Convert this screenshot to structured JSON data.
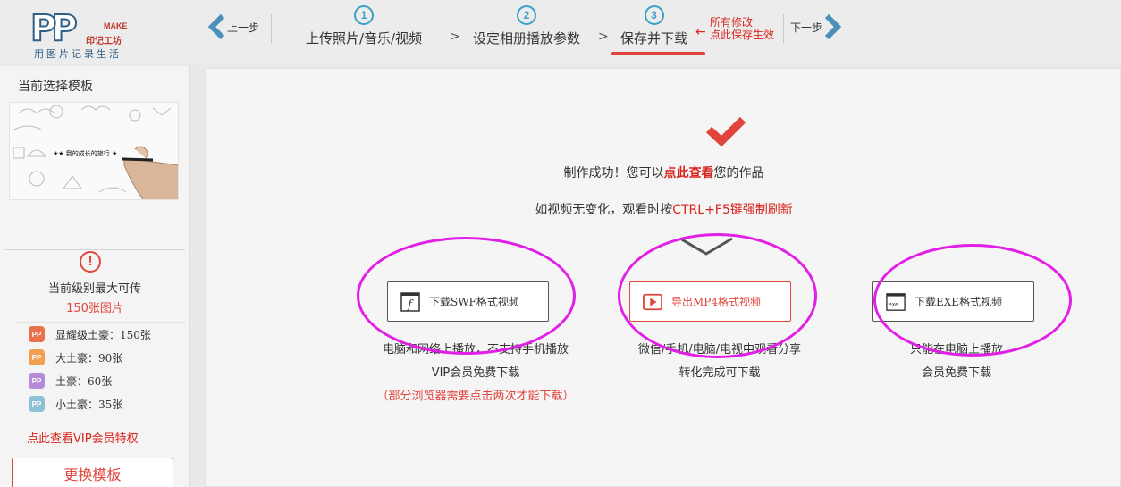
{
  "header": {
    "logo": {
      "big": "PP",
      "make": "MAKE",
      "brand": "印记工坊",
      "slogan": "用图片记录生活"
    },
    "prev_label": "上一步",
    "next_label": "下一步",
    "steps": [
      {
        "num": "1",
        "label": "上传照片/音乐/视频"
      },
      {
        "num": "2",
        "label": "设定相册播放参数"
      },
      {
        "num": "3",
        "label": "保存并下载"
      }
    ],
    "step_arrow": ">",
    "save_note": {
      "line1": "所有修改",
      "line2": "点此保存生效"
    }
  },
  "sidebar": {
    "title": "当前选择模板",
    "thumb_caption": "★★ 我的成长的旅行 ★",
    "warn_glyph": "!",
    "limit_label": "当前级别最大可传",
    "limit_value": "150张图片",
    "levels": [
      {
        "label": "显耀级土豪：150张",
        "color": "#e8724d"
      },
      {
        "label": "大土豪：90张",
        "color": "#f0a050"
      },
      {
        "label": "土豪：60张",
        "color": "#b58ad9"
      },
      {
        "label": "小土豪：35张",
        "color": "#8fc1d6"
      }
    ],
    "vip_link": "点此查看VIP会员特权",
    "change_button": "更换模板"
  },
  "main": {
    "success": {
      "prefix": "制作成功！您可以",
      "link": "点此查看",
      "suffix": "您的作品"
    },
    "refresh": {
      "prefix": "如视频无变化，观看时按",
      "highlight": "CTRL+F5键强制刷新"
    },
    "downloads": [
      {
        "label": "下载SWF格式视频",
        "desc": [
          "电脑和网络上播放，不支持手机播放",
          "VIP会员免费下载"
        ],
        "note": "（部分浏览器需要点击两次才能下载）"
      },
      {
        "label": "导出MP4格式视频",
        "desc": [
          "微信/手机/电脑/电视中观看分享",
          "转化完成可下载"
        ]
      },
      {
        "label": "下载EXE格式视频",
        "icon_text": "exe",
        "desc": [
          "只能在电脑上播放",
          "会员免费下载"
        ]
      }
    ]
  },
  "colors": {
    "accent": "#e0443c",
    "step_blue": "#3a9fc9",
    "annotation": "#e11fe6"
  }
}
